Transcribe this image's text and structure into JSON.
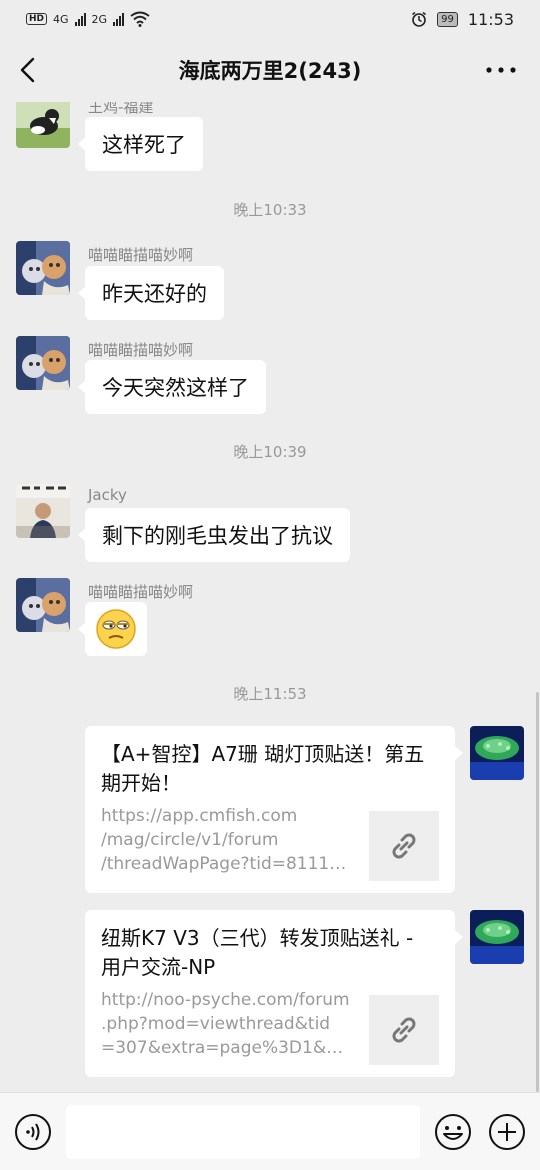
{
  "status_bar": {
    "hd": "HD",
    "sim1": "4G",
    "sim2": "2G",
    "battery": "99",
    "time": "11:53"
  },
  "header": {
    "title": "海底两万里2(243)"
  },
  "messages": [
    {
      "nick": "王鸡-福建",
      "text": "这样死了"
    },
    {
      "nick": "喵喵瞄描喵妙啊",
      "text": "昨天还好的"
    },
    {
      "nick": "喵喵瞄描喵妙啊",
      "text": "今天突然这样了"
    },
    {
      "nick": "Jacky",
      "text": "剩下的刚毛虫发出了抗议"
    },
    {
      "nick": "喵喵瞄描喵妙啊",
      "text": "😒"
    }
  ],
  "timestamps": [
    "晚上10:33",
    "晚上10:39",
    "晚上11:53"
  ],
  "link_cards": [
    {
      "title": "【A+智控】A7珊 瑚灯顶贴送！第五期开始！",
      "desc": [
        "https://app.cmfish.com",
        "/mag/circle/v1/forum",
        "/threadWapPage?tid=81119..."
      ]
    },
    {
      "title": "纽斯K7 V3（三代）转发顶贴送礼 - 用户交流-NP",
      "desc": [
        "http://noo-psyche.com/forum",
        ".php?mod=viewthread&tid",
        "=307&extra=page%3D1&mo..."
      ]
    }
  ],
  "input": {
    "placeholder": ""
  },
  "colors": {
    "background": "#ededed",
    "bubble": "#ffffff",
    "meta_text": "#999999"
  }
}
